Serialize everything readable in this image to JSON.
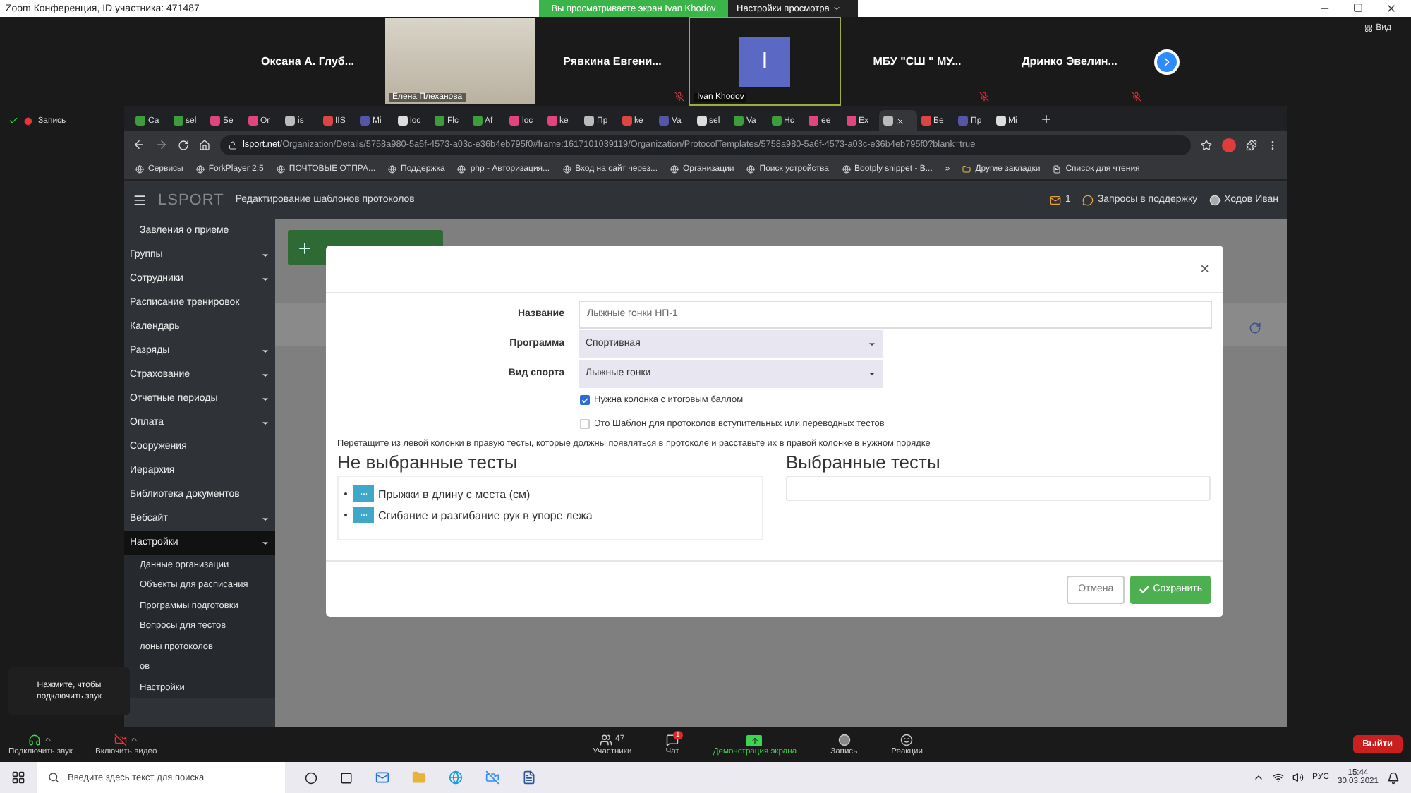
{
  "zoom": {
    "title": "Zoom Конференция, ID участника: 471487",
    "sharing_banner": "Вы просматриваете экран Ivan Khodov",
    "view_options": "Настройки просмотра",
    "view_button": "Вид",
    "recording": "Запись"
  },
  "participants": [
    {
      "kind": "name",
      "name": "Оксана  А.  Глуб...",
      "muted": false
    },
    {
      "kind": "video",
      "name": "Елена Плеханова",
      "muted": false
    },
    {
      "kind": "name",
      "name": "Рявкина  Евгени...",
      "muted": true
    },
    {
      "kind": "avatar",
      "name": "Ivan Khodov",
      "initial": "I",
      "muted": false
    },
    {
      "kind": "name",
      "name": "МБУ  \"СШ \"  МУ...",
      "muted": true
    },
    {
      "kind": "name",
      "name": "Дринко  Эвелин...",
      "muted": true
    }
  ],
  "browser": {
    "tabs": [
      {
        "label": "Са",
        "selected": false
      },
      {
        "label": "sel",
        "selected": false
      },
      {
        "label": "Бе",
        "selected": false
      },
      {
        "label": "Or",
        "selected": false
      },
      {
        "label": "is",
        "selected": false
      },
      {
        "label": "IIS",
        "selected": false
      },
      {
        "label": "Mi",
        "selected": false
      },
      {
        "label": "loc",
        "selected": false
      },
      {
        "label": "Flc",
        "selected": false
      },
      {
        "label": "Af",
        "selected": false
      },
      {
        "label": "loc",
        "selected": false
      },
      {
        "label": "ke",
        "selected": false
      },
      {
        "label": "Пр",
        "selected": false
      },
      {
        "label": "ke",
        "selected": false
      },
      {
        "label": "Va",
        "selected": false
      },
      {
        "label": "sel",
        "selected": false
      },
      {
        "label": "Va",
        "selected": false
      },
      {
        "label": "Hc",
        "selected": false
      },
      {
        "label": "ee",
        "selected": false
      },
      {
        "label": "Ex",
        "selected": false
      },
      {
        "selected": true
      },
      {
        "label": "Бе",
        "selected": false
      },
      {
        "label": "Пр",
        "selected": false
      },
      {
        "label": "Mi",
        "selected": false
      }
    ],
    "url_host": "lsport.net",
    "url_path": "/Organization/Details/5758a980-5a6f-4573-a03c-e36b4eb795f0#frame:1617101039119/Organization/ProtocolTemplates/5758a980-5a6f-4573-a03c-e36b4eb795f0?blank=true",
    "bookmarks": [
      "Сервисы",
      "ForkPlayer 2.5",
      "ПОЧТОВЫЕ ОТПРА...",
      "Поддержка",
      "php - Авторизация...",
      "Вход на сайт через...",
      "Организации",
      "Поиск устройства",
      "Bootply snippet - B..."
    ],
    "more_bookmarks": "»",
    "other_bookmarks": "Другие закладки",
    "reading_list": "Список для чтения"
  },
  "app": {
    "logo": "LSPORT",
    "page_title": "Редактирование шаблонов протоколов",
    "mail_count": "1",
    "support": "Запросы в поддержку",
    "user": "Ходов Иван"
  },
  "sidebar": [
    {
      "label": "Завления о приеме",
      "sub": true,
      "caret": false,
      "selected": false
    },
    {
      "label": "Группы",
      "caret": true,
      "selected": false
    },
    {
      "label": "Сотрудники",
      "caret": true,
      "selected": false
    },
    {
      "label": "Расписание тренировок",
      "caret": false,
      "selected": false
    },
    {
      "label": "Календарь",
      "caret": false,
      "selected": false
    },
    {
      "label": "Разряды",
      "caret": true,
      "selected": false
    },
    {
      "label": "Страхование",
      "caret": true,
      "selected": false
    },
    {
      "label": "Отчетные периоды",
      "caret": true,
      "selected": false
    },
    {
      "label": "Оплата",
      "caret": true,
      "selected": false
    },
    {
      "label": "Сооружения",
      "caret": false,
      "selected": false
    },
    {
      "label": "Иерархия",
      "caret": false,
      "selected": false
    },
    {
      "label": "Библиотека документов",
      "caret": false,
      "selected": false
    },
    {
      "label": "Вебсайт",
      "caret": true,
      "selected": false
    },
    {
      "label": "Настройки",
      "caret": true,
      "selected": true,
      "children": [
        {
          "label": "Данные организации"
        },
        {
          "label": "Объекты для расписания"
        },
        {
          "label": "Программы подготовки"
        },
        {
          "label": "Вопросы для тестов"
        },
        {
          "label": "лоны протоколов"
        },
        {
          "label": "ов"
        },
        {
          "label": "Настройки"
        }
      ]
    }
  ],
  "modal": {
    "close": "×",
    "fields": [
      {
        "kind": "input",
        "label": "Название",
        "value": "Лыжные гонки НП-1"
      },
      {
        "kind": "select",
        "label": "Программа",
        "value": "Спортивная"
      },
      {
        "kind": "select",
        "label": "Вид спорта",
        "value": "Лыжные гонки"
      }
    ],
    "checks": [
      {
        "label": "Нужна колонка с итоговым баллом",
        "checked": true
      },
      {
        "label": "Это Шаблон для протоколов вступительных или переводных тестов",
        "checked": false
      }
    ],
    "hint": "Перетащите из левой колонки в правую тесты, которые должны появляться в протоколе и расставьте их в правой колонке в нужном порядке",
    "unselected_title": "Не выбранные тесты",
    "unselected": [
      "Прыжки в длину с места (см)",
      "Сгибание и разгибание рук в упоре лежа"
    ],
    "selected_title": "Выбранные тесты",
    "cancel": "Отмена",
    "save": "Сохранить"
  },
  "tooltip": "Нажмите, чтобы подключить звук",
  "toolbar": {
    "audio": "Подключить звук",
    "video": "Включить видео",
    "participants": "Участники",
    "participants_count": "47",
    "chat": "Чат",
    "chat_badge": "1",
    "share": "Демонстрация экрана",
    "record": "Запись",
    "reactions": "Реакции",
    "leave": "Выйти"
  },
  "taskbar": {
    "search_placeholder": "Введите здесь текст для поиска",
    "language": "РУС",
    "time": "15:44",
    "date": "30.03.2021"
  }
}
